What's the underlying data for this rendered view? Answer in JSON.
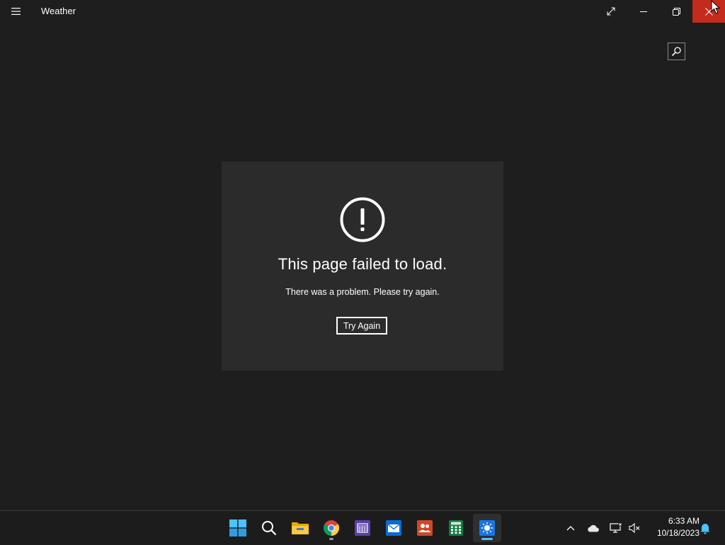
{
  "window": {
    "title": "Weather",
    "controls": [
      "fullscreen",
      "minimize",
      "restore",
      "close"
    ],
    "close_hover_color": "#c42b1c"
  },
  "error": {
    "icon": "exclamation-circle-icon",
    "title": "This page failed to load.",
    "message": "There was a problem. Please try again.",
    "retry_label": "Try Again"
  },
  "taskbar": {
    "apps": [
      {
        "name": "start",
        "icon": "windows-logo-icon"
      },
      {
        "name": "search",
        "icon": "search-icon"
      },
      {
        "name": "file-explorer",
        "icon": "folder-icon"
      },
      {
        "name": "chrome",
        "icon": "chrome-icon",
        "running": true
      },
      {
        "name": "calendar",
        "icon": "calendar-icon"
      },
      {
        "name": "mail",
        "icon": "mail-icon"
      },
      {
        "name": "people",
        "icon": "people-icon"
      },
      {
        "name": "calculator",
        "icon": "calculator-icon"
      },
      {
        "name": "weather",
        "icon": "weather-sun-icon",
        "active": true
      }
    ],
    "tray": [
      "chevron-up-icon",
      "onedrive-cloud-icon",
      "network-icon",
      "volume-muted-icon",
      "notification-bell-icon"
    ],
    "time": "6:33 AM",
    "date": "10/18/2023",
    "accent": "#4cc2ff"
  }
}
